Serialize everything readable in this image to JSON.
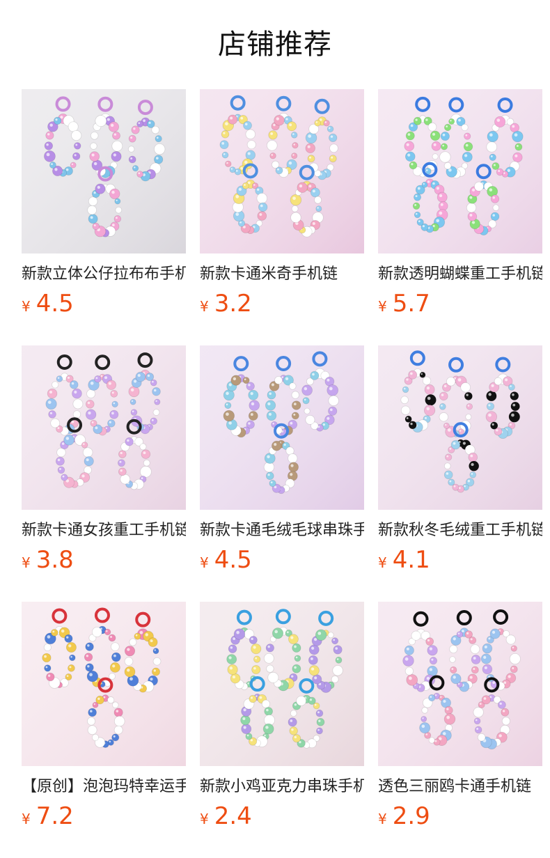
{
  "page": {
    "title": "店铺推荐"
  },
  "products": [
    {
      "name": "新款立体公仔拉布布手机链",
      "currency": "¥",
      "price": "4.5",
      "bg": "#d9d6dc",
      "accent": "#c98bd8",
      "beads": [
        "#f3a6d4",
        "#b78ee6",
        "#ffffff",
        "#7fc4ea"
      ]
    },
    {
      "name": "新款卡通米奇手机链",
      "currency": "¥",
      "price": "3.2",
      "bg": "#e8c7de",
      "accent": "#4f8fe0",
      "beads": [
        "#f3a6c2",
        "#9ad0f0",
        "#f6e27a",
        "#ffffff"
      ]
    },
    {
      "name": "新款透明蝴蝶重工手机链",
      "currency": "¥",
      "price": "5.7",
      "bg": "#e9cfe4",
      "accent": "#3b7be0",
      "beads": [
        "#7cc7f0",
        "#8be07a",
        "#f6a6d8",
        "#ffffff"
      ]
    },
    {
      "name": "新款卡通女孩重工手机链",
      "currency": "¥",
      "price": "3.8",
      "bg": "#e8d2e2",
      "accent": "#222222",
      "beads": [
        "#f5b3d0",
        "#ffffff",
        "#9cc4f0",
        "#c9a6ee"
      ]
    },
    {
      "name": "新款卡通毛绒毛球串珠手机链",
      "currency": "¥",
      "price": "4.5",
      "bg": "#e1cbe6",
      "accent": "#4a86e0",
      "beads": [
        "#c6a6ee",
        "#ffffff",
        "#8fd0e8",
        "#b89a7a"
      ]
    },
    {
      "name": "新款秋冬毛绒重工手机链",
      "currency": "¥",
      "price": "4.1",
      "bg": "#e6cfe2",
      "accent": "#3f7ee0",
      "beads": [
        "#f2b4d6",
        "#9fd2ee",
        "#ffffff",
        "#111111"
      ]
    },
    {
      "name": "【原创】泡泡玛特幸运手机链",
      "currency": "¥",
      "price": "7.2",
      "bg": "#f0d8e2",
      "accent": "#d8333b",
      "beads": [
        "#ffffff",
        "#4f7fd8",
        "#f2c94c",
        "#ef8ab4"
      ]
    },
    {
      "name": "新款小鸡亚克力串珠手机链",
      "currency": "¥",
      "price": "2.4",
      "bg": "#e8d6dc",
      "accent": "#3aa0e0",
      "beads": [
        "#f6e27a",
        "#ffffff",
        "#8fd6a8",
        "#b49ae8"
      ]
    },
    {
      "name": "透色三丽鸥卡通手机链",
      "currency": "¥",
      "price": "2.9",
      "bg": "#ecd2e2",
      "accent": "#111111",
      "beads": [
        "#ffffff",
        "#f3a6c2",
        "#9cc4f0",
        "#c9a6ee"
      ]
    }
  ]
}
